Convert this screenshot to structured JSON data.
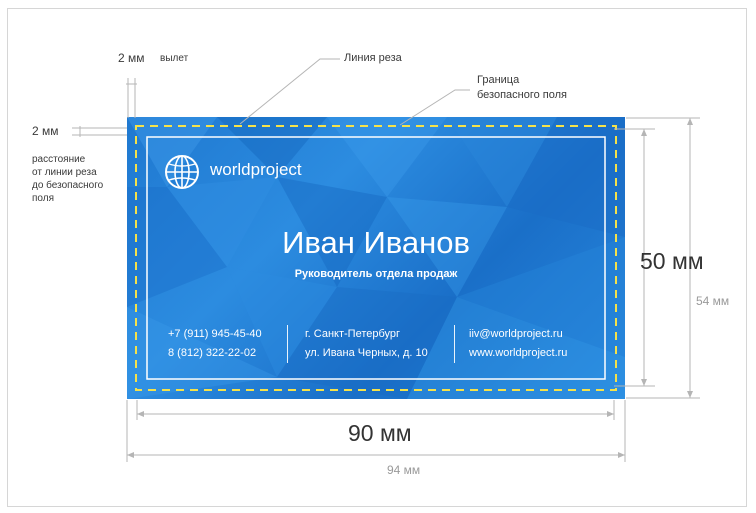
{
  "annotations": {
    "bleed_value": "2 мм",
    "bleed_label": "вылет",
    "cut_line": "Линия реза",
    "safe_border_line1": "Граница",
    "safe_border_line2": "безопасного поля",
    "safe_distance_value": "2 мм",
    "safe_distance_desc": [
      "расстояние",
      "от линии реза",
      "до безопасного",
      "поля"
    ],
    "trim_height": "50 мм",
    "full_height": "54 мм",
    "trim_width": "90 мм",
    "full_width": "94 мм"
  },
  "card": {
    "brand": "worldproject",
    "name": "Иван Иванов",
    "position": "Руководитель отдела продаж",
    "phone1": "+7 (911) 945-45-40",
    "phone2": "8 (812) 322-22-02",
    "city": "г. Санкт-Петербург",
    "street": "ул. Ивана Черных, д. 10",
    "email": "iiv@worldproject.ru",
    "website": "www.worldproject.ru"
  },
  "colors": {
    "card_blue": "#1f78d0",
    "cut_line": "#ffffff",
    "safe_line": "#f5e24a",
    "dimension_line": "#b5b5b5"
  },
  "icons": [
    "globe-icon"
  ]
}
